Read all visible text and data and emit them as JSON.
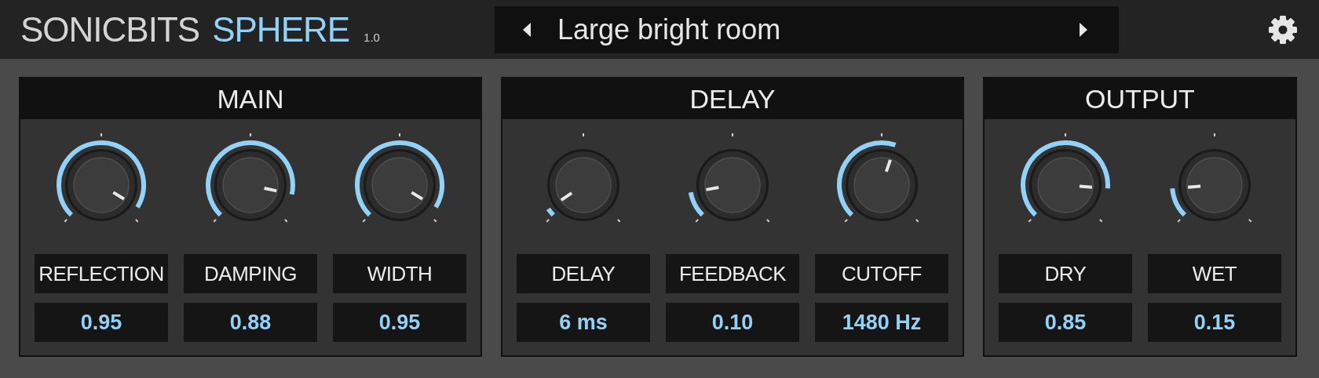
{
  "header": {
    "brand": "SONICBITS",
    "product": "SPHERE",
    "version": "1.0"
  },
  "preset": {
    "name": "Large bright room"
  },
  "sections": [
    {
      "title": "MAIN",
      "controls": [
        {
          "label": "REFLECTION",
          "value": "0.95"
        },
        {
          "label": "DAMPING",
          "value": "0.88"
        },
        {
          "label": "WIDTH",
          "value": "0.95"
        }
      ]
    },
    {
      "title": "DELAY",
      "controls": [
        {
          "label": "DELAY",
          "value": "6 ms"
        },
        {
          "label": "FEEDBACK",
          "value": "0.10"
        },
        {
          "label": "CUTOFF",
          "value": "1480 Hz"
        }
      ]
    },
    {
      "title": "OUTPUT",
      "controls": [
        {
          "label": "DRY",
          "value": "0.85"
        },
        {
          "label": "WET",
          "value": "0.15"
        }
      ]
    }
  ]
}
